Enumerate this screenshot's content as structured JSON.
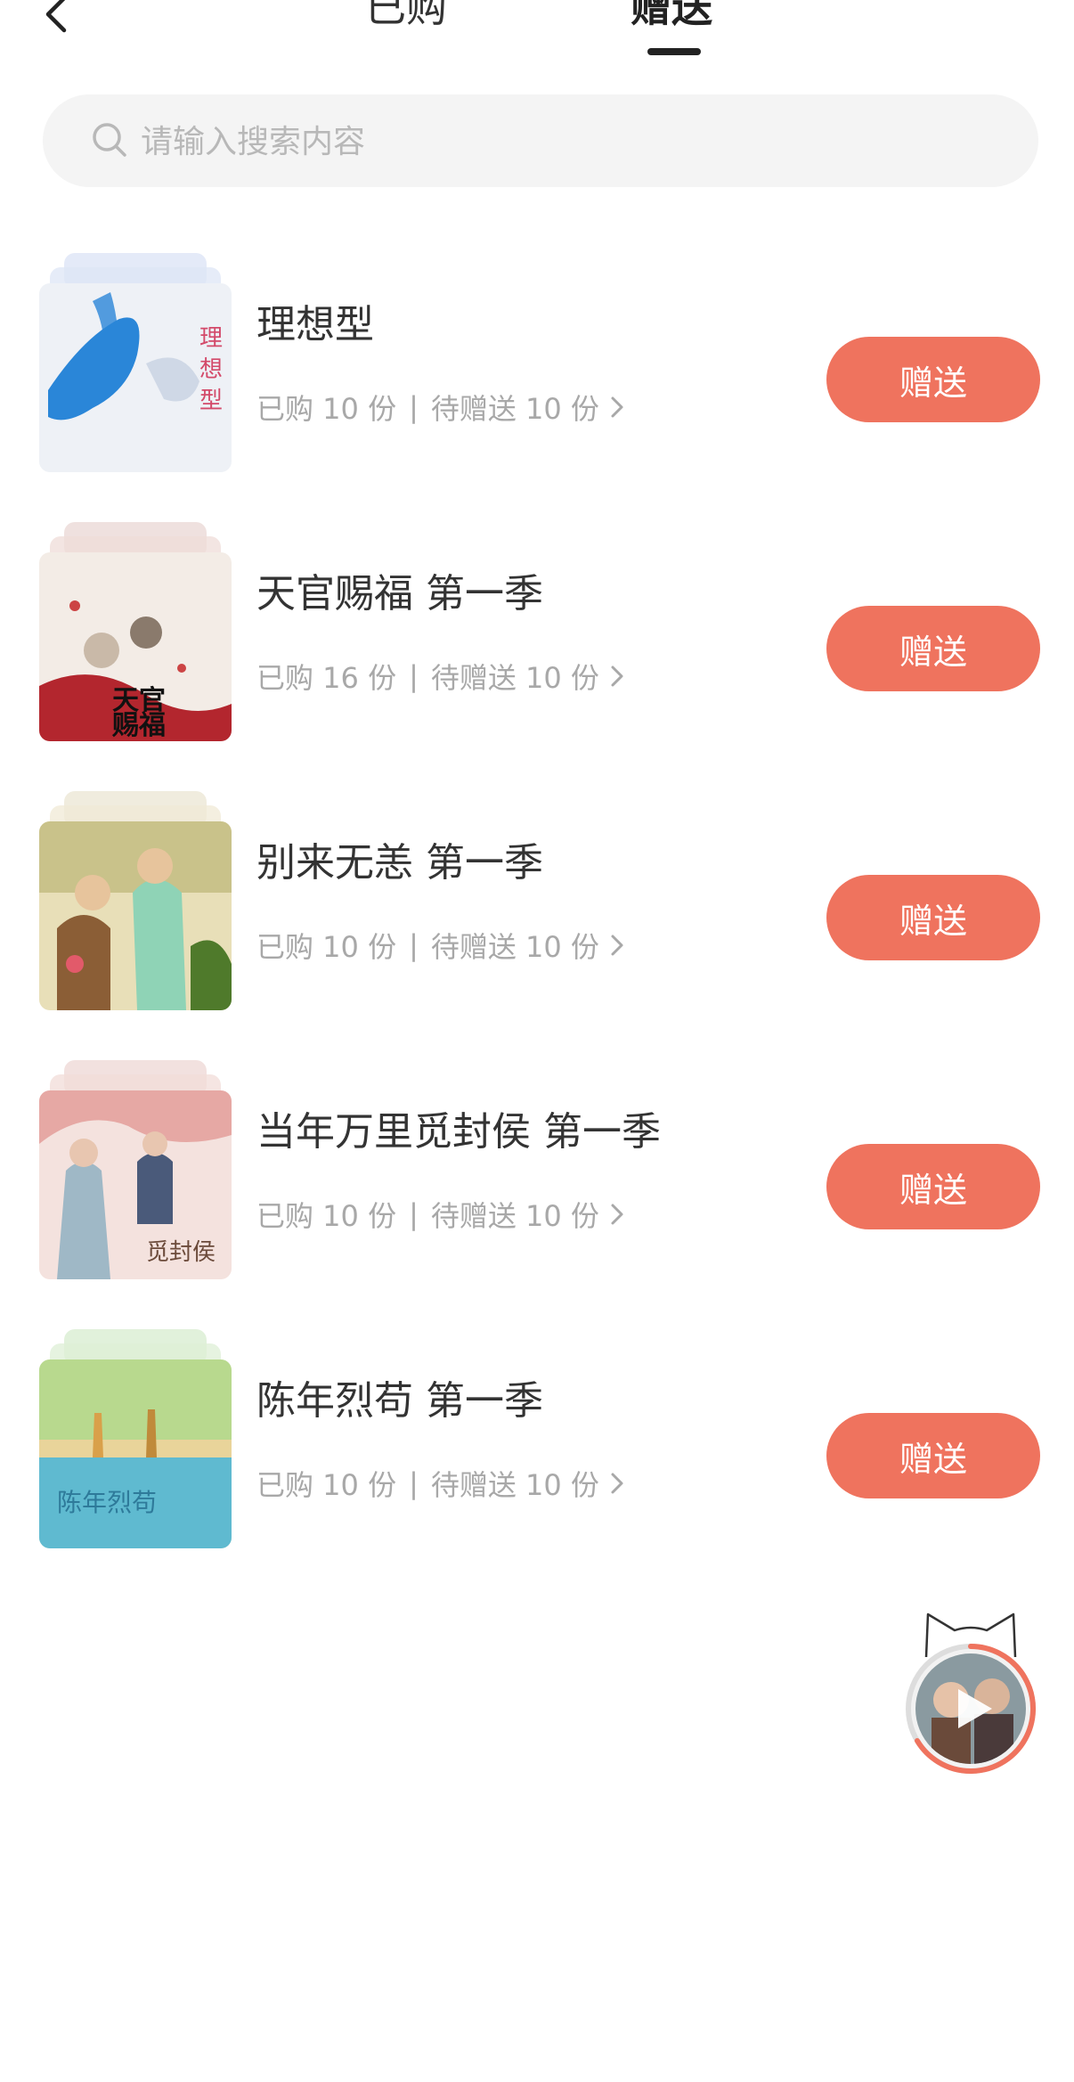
{
  "header": {
    "tabs": [
      {
        "label": "已购"
      },
      {
        "label": "赠送"
      }
    ],
    "active_tab": "赠送"
  },
  "search": {
    "placeholder": "请输入搜索内容",
    "value": ""
  },
  "items": [
    {
      "title": "理想型",
      "purchased": "已购 10 份",
      "pending": "待赠送 10 份",
      "button": "赠送",
      "cover_colors": [
        "#dbe3f5",
        "#2a86d8"
      ]
    },
    {
      "title": "天官赐福 第一季",
      "purchased": "已购 16 份",
      "pending": "待赠送 10 份",
      "button": "赠送",
      "cover_colors": [
        "#e9d7d2",
        "#b3262e"
      ]
    },
    {
      "title": "别来无恙 第一季",
      "purchased": "已购 10 份",
      "pending": "待赠送 10 份",
      "button": "赠送",
      "cover_colors": [
        "#efe6cf",
        "#6c8a3d"
      ]
    },
    {
      "title": "当年万里觅封侯 第一季",
      "purchased": "已购 10 份",
      "pending": "待赠送 10 份",
      "button": "赠送",
      "cover_colors": [
        "#f1d9d6",
        "#c98b86"
      ]
    },
    {
      "title": "陈年烈苟 第一季",
      "purchased": "已购 10 份",
      "pending": "待赠送 10 份",
      "button": "赠送",
      "cover_colors": [
        "#d9ecd0",
        "#5fbad0"
      ]
    }
  ],
  "separator": "|",
  "colors": {
    "accent": "#ef735e",
    "text_primary": "#333333",
    "text_secondary": "#a8a8a8",
    "search_bg": "#f4f4f4"
  },
  "icons": {
    "back": "chevron-left-icon",
    "search": "search-icon",
    "more": "chevron-right-icon",
    "player": "play-icon"
  }
}
